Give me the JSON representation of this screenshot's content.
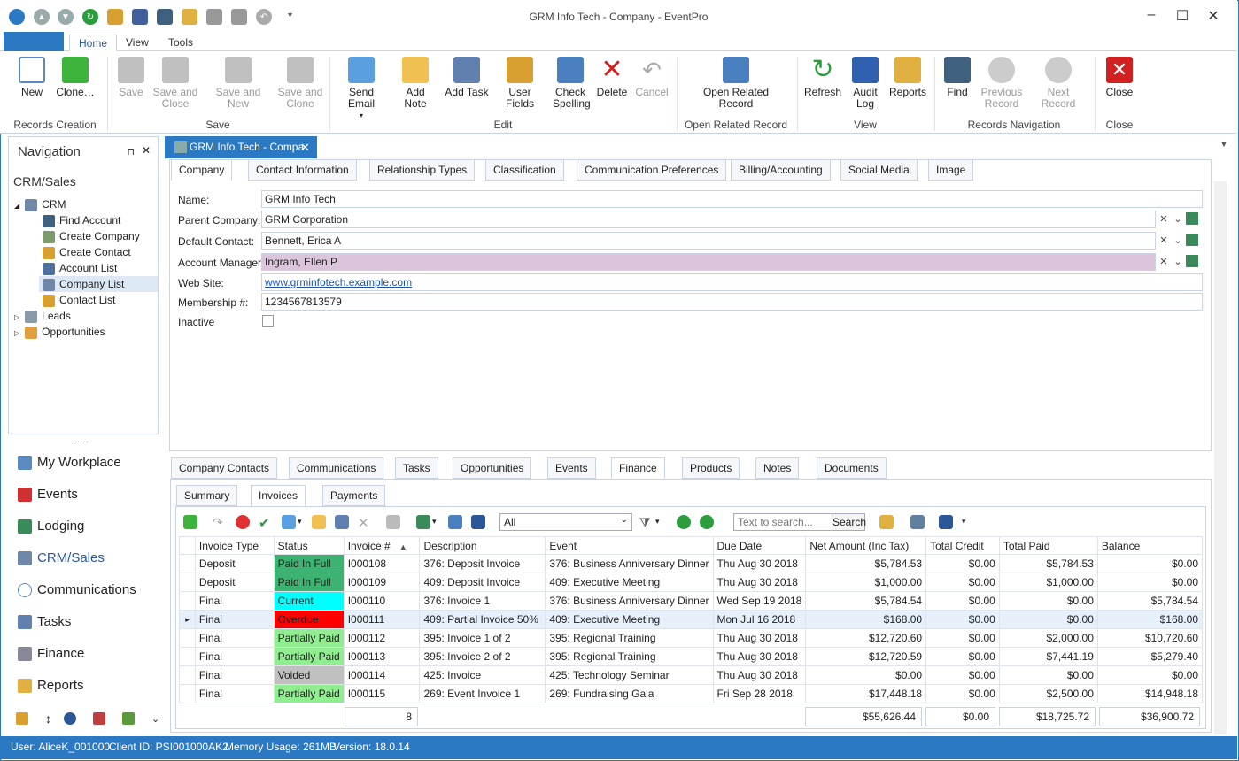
{
  "window": {
    "title": "GRM Info Tech - Company - EventPro"
  },
  "ribbon_tabs": [
    "Home",
    "View",
    "Tools"
  ],
  "ribbon": {
    "new": "New",
    "clone": "Clone…",
    "save": "Save",
    "save_close": "Save and Close",
    "save_new": "Save and New",
    "save_clone": "Save and Clone",
    "send_email": "Send Email",
    "add_note": "Add Note",
    "add_task": "Add Task",
    "user_fields": "User Fields",
    "check_spelling": "Check Spelling",
    "delete": "Delete",
    "cancel": "Cancel",
    "open_related": "Open Related Record",
    "refresh": "Refresh",
    "audit_log": "Audit Log",
    "reports": "Reports",
    "find": "Find",
    "prev_record": "Previous Record",
    "next_record": "Next Record",
    "close": "Close",
    "groups": {
      "records_creation": "Records Creation",
      "save": "Save",
      "edit": "Edit",
      "open_related": "Open Related Record",
      "view": "View",
      "records_nav": "Records Navigation",
      "close": "Close"
    }
  },
  "nav": {
    "title": "Navigation",
    "section": "CRM/Sales",
    "tree": {
      "crm": "CRM",
      "find_account": "Find Account",
      "create_company": "Create Company",
      "create_contact": "Create Contact",
      "account_list": "Account List",
      "company_list": "Company List",
      "contact_list": "Contact List",
      "leads": "Leads",
      "opportunities": "Opportunities"
    },
    "buttons": [
      "My Workplace",
      "Events",
      "Lodging",
      "CRM/Sales",
      "Communications",
      "Tasks",
      "Finance",
      "Reports"
    ]
  },
  "doc_tab": "GRM Info Tech - Compa",
  "page_tabs": [
    "Company",
    "Contact Information",
    "Relationship Types",
    "Classification",
    "Communication Preferences",
    "Billing/Accounting",
    "Social Media",
    "Image"
  ],
  "form": {
    "name_label": "Name:",
    "name": "GRM Info Tech",
    "parent_label": "Parent Company:",
    "parent": "GRM Corporation",
    "contact_label": "Default Contact:",
    "contact": "Bennett, Erica A",
    "manager_label": "Account Manager:",
    "manager": "Ingram, Ellen P",
    "web_label": "Web Site:",
    "web": "www.grminfotech.example.com",
    "member_label": "Membership #:",
    "member": "1234567813579",
    "inactive_label": "Inactive"
  },
  "bottom_tabs": [
    "Company Contacts",
    "Communications",
    "Tasks",
    "Opportunities",
    "Events",
    "Finance",
    "Products",
    "Notes",
    "Documents"
  ],
  "sub_tabs": [
    "Summary",
    "Invoices",
    "Payments"
  ],
  "toolbar": {
    "filter_value": "All",
    "search_placeholder": "Text to search...",
    "search_btn": "Search"
  },
  "grid": {
    "headers": [
      "Invoice Type",
      "Status",
      "Invoice #",
      "Description",
      "Event",
      "Due Date",
      "Net Amount (Inc Tax)",
      "Total Credit",
      "Total Paid",
      "Balance"
    ],
    "rows": [
      [
        "Deposit",
        "Paid In Full",
        "I000108",
        "376: Deposit Invoice",
        "376: Business Anniversary Dinner",
        "Thu Aug 30 2018",
        "$5,784.53",
        "$0.00",
        "$5,784.53",
        "$0.00"
      ],
      [
        "Deposit",
        "Paid In Full",
        "I000109",
        "409: Deposit Invoice",
        "409: Executive Meeting",
        "Thu Aug 30 2018",
        "$1,000.00",
        "$0.00",
        "$1,000.00",
        "$0.00"
      ],
      [
        "Final",
        "Current",
        "I000110",
        "376: Invoice 1",
        "376: Business Anniversary Dinner",
        "Wed Sep 19 2018",
        "$5,784.54",
        "$0.00",
        "$0.00",
        "$5,784.54"
      ],
      [
        "Final",
        "Overdue",
        "I000111",
        "409: Partial Invoice 50%",
        "409: Executive Meeting",
        "Mon Jul 16 2018",
        "$168.00",
        "$0.00",
        "$0.00",
        "$168.00"
      ],
      [
        "Final",
        "Partially Paid",
        "I000112",
        "395: Invoice 1 of 2",
        "395: Regional Training",
        "Thu Aug 30 2018",
        "$12,720.60",
        "$0.00",
        "$2,000.00",
        "$10,720.60"
      ],
      [
        "Final",
        "Partially Paid",
        "I000113",
        "395: Invoice 2 of 2",
        "395: Regional Training",
        "Thu Aug 30 2018",
        "$12,720.59",
        "$0.00",
        "$7,441.19",
        "$5,279.40"
      ],
      [
        "Final",
        "Voided",
        "I000114",
        "425: Invoice",
        "425: Technology Seminar",
        "Thu Aug 30 2018",
        "$0.00",
        "$0.00",
        "$0.00",
        "$0.00"
      ],
      [
        "Final",
        "Partially Paid",
        "I000115",
        "269: Event Invoice 1",
        "269: Fundraising Gala",
        "Fri Sep 28 2018",
        "$17,448.18",
        "$0.00",
        "$2,500.00",
        "$14,948.18"
      ]
    ],
    "status_colors": {
      "Paid In Full": "#3cb371",
      "Current": "#00ffff",
      "Overdue": "#ff0000",
      "Partially Paid": "#90ee90",
      "Voided": "#c0c0c0"
    },
    "totals": {
      "count": "8",
      "net": "$55,626.44",
      "credit": "$0.00",
      "paid": "$18,725.72",
      "balance": "$36,900.72"
    }
  },
  "status": {
    "user": "User: AliceK_001000",
    "client": "Client ID: PSI001000AK2",
    "memory": "Memory Usage: 261MB",
    "version": "Version: 18.0.14"
  }
}
